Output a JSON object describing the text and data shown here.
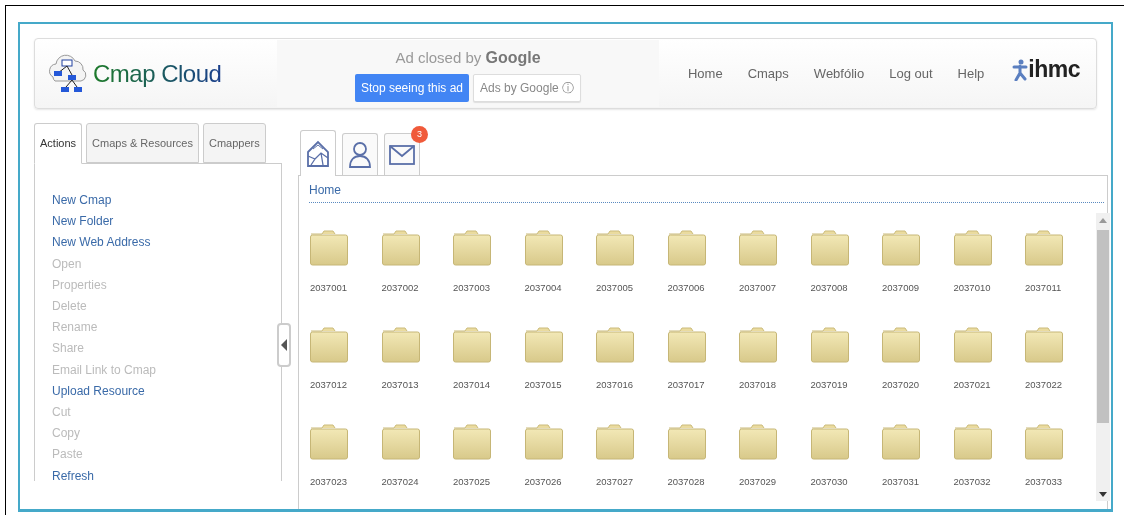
{
  "header": {
    "logo_text": "Cmap Cloud",
    "ad": {
      "notice": "Ad closed by",
      "notice_brand": "Google",
      "stop_button": "Stop seeing this ad",
      "ads_by_button": "Ads by Google ⓘ"
    },
    "nav": [
      "Home",
      "Cmaps",
      "Webfólio",
      "Log out",
      "Help"
    ],
    "brand_text": "ihmc"
  },
  "left_tabs": [
    {
      "label": "Actions",
      "selected": true
    },
    {
      "label": "Cmaps & Resources",
      "selected": false
    },
    {
      "label": "Cmappers",
      "selected": false
    }
  ],
  "actions": [
    {
      "label": "New Cmap",
      "disabled": false
    },
    {
      "label": "New Folder",
      "disabled": false
    },
    {
      "label": "New Web Address",
      "disabled": false
    },
    {
      "label": "Open",
      "disabled": true
    },
    {
      "label": "Properties",
      "disabled": true
    },
    {
      "label": "Delete",
      "disabled": true
    },
    {
      "label": "Rename",
      "disabled": true
    },
    {
      "label": "Share",
      "disabled": true
    },
    {
      "label": "Email Link to Cmap",
      "disabled": true
    },
    {
      "label": "Upload Resource",
      "disabled": false
    },
    {
      "label": "Cut",
      "disabled": true
    },
    {
      "label": "Copy",
      "disabled": true
    },
    {
      "label": "Paste",
      "disabled": true
    },
    {
      "label": "Refresh",
      "disabled": false
    }
  ],
  "icon_tabs": [
    {
      "kind": "home",
      "selected": true
    },
    {
      "kind": "person",
      "selected": false
    },
    {
      "kind": "mail",
      "selected": false,
      "badge": "3"
    }
  ],
  "breadcrumb": "Home",
  "folders": [
    "2037001",
    "2037002",
    "2037003",
    "2037004",
    "2037005",
    "2037006",
    "2037007",
    "2037008",
    "2037009",
    "2037010",
    "2037011",
    "2037012",
    "2037013",
    "2037014",
    "2037015",
    "2037016",
    "2037017",
    "2037018",
    "2037019",
    "2037020",
    "2037021",
    "2037022",
    "2037023",
    "2037024",
    "2037025",
    "2037026",
    "2037027",
    "2037028",
    "2037029",
    "2037030",
    "2037031",
    "2037032",
    "2037033"
  ]
}
